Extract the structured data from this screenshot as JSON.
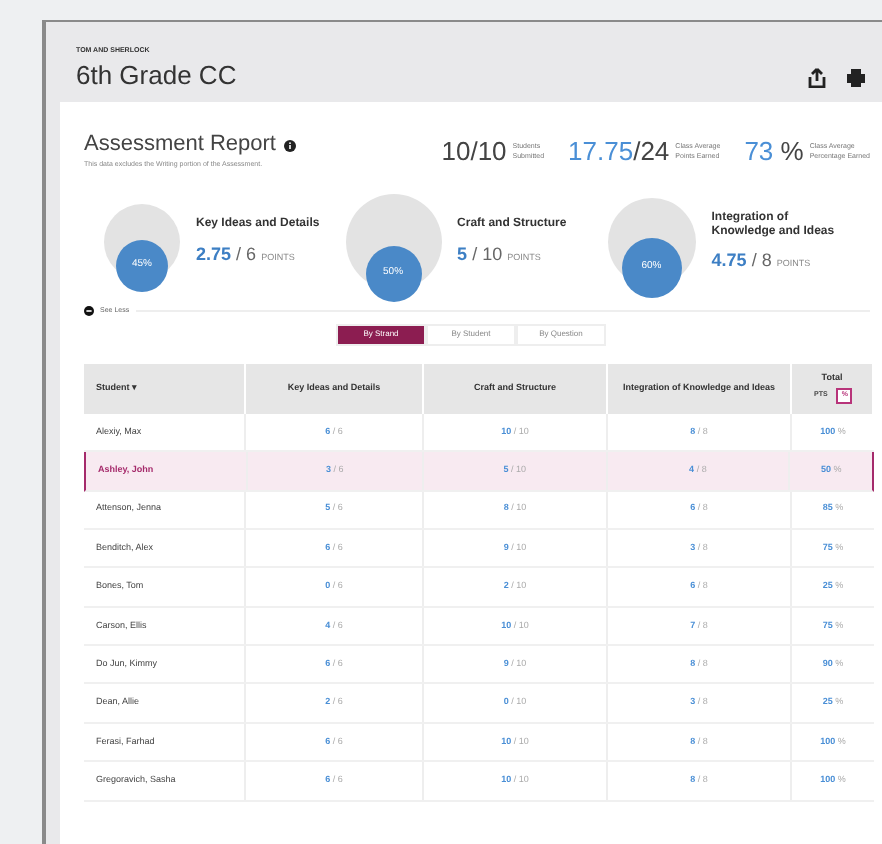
{
  "header": {
    "caption": "TOM AND SHERLOCK",
    "title": "6th Grade CC"
  },
  "report": {
    "title": "Assessment Report",
    "subtitle": "This data excludes the Writing portion of the Assessment."
  },
  "stats": [
    {
      "value": "10",
      "total": "/10",
      "label_1": "Students",
      "label_2": "Submitted",
      "highlight": false
    },
    {
      "value": "17.75",
      "total": "/24",
      "label_1": "Class Average",
      "label_2": "Points Earned",
      "highlight": true
    },
    {
      "value": "73",
      "total": " %",
      "label_1": "Class Average",
      "label_2": "Percentage Earned",
      "highlight": true
    }
  ],
  "strands": [
    {
      "name": "Key Ideas and Details",
      "percent": "45%",
      "earned": "2.75",
      "total": "/ 6",
      "unit": "POINTS"
    },
    {
      "name": "Craft and Structure",
      "percent": "50%",
      "earned": "5",
      "total": "/ 10",
      "unit": "POINTS"
    },
    {
      "name": "Integration of Knowledge and Ideas",
      "percent": "60%",
      "earned": "4.75",
      "total": "/ 8",
      "unit": "POINTS"
    }
  ],
  "see_less": "See Less",
  "tabs": [
    {
      "label": "By Strand",
      "selected": true
    },
    {
      "label": "By Student",
      "selected": false
    },
    {
      "label": "By Question",
      "selected": false
    }
  ],
  "table": {
    "columns": [
      "Student ▾",
      "Key Ideas and Details",
      "Craft and Structure",
      "Integration of Knowledge and Ideas",
      "Total"
    ],
    "total_toggle": [
      {
        "label": "PTS",
        "selected": false
      },
      {
        "label": "%",
        "selected": true
      }
    ],
    "rows": [
      {
        "student": "Alexiy, Max",
        "selected": false,
        "scores": [
          [
            "6",
            "/ 6"
          ],
          [
            "10",
            "/ 10"
          ],
          [
            "8",
            "/ 8"
          ]
        ],
        "total": "100",
        "unit": "%"
      },
      {
        "student": "Ashley, John",
        "selected": true,
        "scores": [
          [
            "3",
            "/ 6"
          ],
          [
            "5",
            "/ 10"
          ],
          [
            "4",
            "/ 8"
          ]
        ],
        "total": "50",
        "unit": "%"
      },
      {
        "student": "Attenson, Jenna",
        "selected": false,
        "scores": [
          [
            "5",
            "/ 6"
          ],
          [
            "8",
            "/ 10"
          ],
          [
            "6",
            "/ 8"
          ]
        ],
        "total": "85",
        "unit": "%"
      },
      {
        "student": "Benditch, Alex",
        "selected": false,
        "scores": [
          [
            "6",
            "/ 6"
          ],
          [
            "9",
            "/ 10"
          ],
          [
            "3",
            "/ 8"
          ]
        ],
        "total": "75",
        "unit": "%"
      },
      {
        "student": "Bones, Tom",
        "selected": false,
        "scores": [
          [
            "0",
            "/ 6"
          ],
          [
            "2",
            "/ 10"
          ],
          [
            "6",
            "/ 8"
          ]
        ],
        "total": "25",
        "unit": "%"
      },
      {
        "student": "Carson, Ellis",
        "selected": false,
        "scores": [
          [
            "4",
            "/ 6"
          ],
          [
            "10",
            "/ 10"
          ],
          [
            "7",
            "/ 8"
          ]
        ],
        "total": "75",
        "unit": "%"
      },
      {
        "student": "Do Jun, Kimmy",
        "selected": false,
        "scores": [
          [
            "6",
            "/ 6"
          ],
          [
            "9",
            "/ 10"
          ],
          [
            "8",
            "/ 8"
          ]
        ],
        "total": "90",
        "unit": "%"
      },
      {
        "student": "Dean, Allie",
        "selected": false,
        "scores": [
          [
            "2",
            "/ 6"
          ],
          [
            "0",
            "/ 10"
          ],
          [
            "3",
            "/ 8"
          ]
        ],
        "total": "25",
        "unit": "%"
      },
      {
        "student": "Ferasi, Farhad",
        "selected": false,
        "scores": [
          [
            "6",
            "/ 6"
          ],
          [
            "10",
            "/ 10"
          ],
          [
            "8",
            "/ 8"
          ]
        ],
        "total": "100",
        "unit": "%"
      },
      {
        "student": "Gregoravich, Sasha",
        "selected": false,
        "scores": [
          [
            "6",
            "/ 6"
          ],
          [
            "10",
            "/ 10"
          ],
          [
            "8",
            "/ 8"
          ]
        ],
        "total": "100",
        "unit": "%"
      }
    ]
  }
}
